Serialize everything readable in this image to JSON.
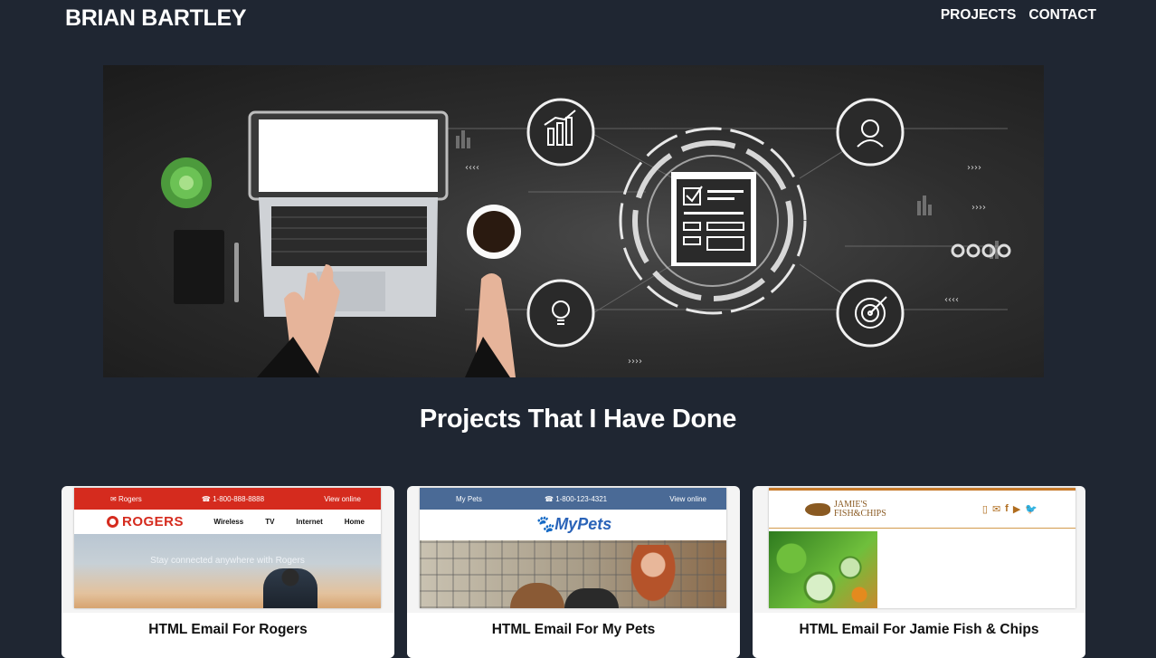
{
  "header": {
    "brand": "BRIAN BARTLEY",
    "nav": [
      {
        "label": "PROJECTS"
      },
      {
        "label": "CONTACT"
      }
    ]
  },
  "hero": {
    "image": "laptop-business-analytics-illustration"
  },
  "projects": {
    "heading": "Projects That I Have Done",
    "cards": [
      {
        "title": "HTML Email For Rogers",
        "preview": {
          "topbar": {
            "left": "Rogers",
            "phone": "1-800-888-8888",
            "right": "View online"
          },
          "logo": "ROGERS",
          "links": [
            "Wireless",
            "TV",
            "Internet",
            "Home"
          ],
          "tagline": "Stay connected anywhere with Rogers",
          "accent": "#d52b1e"
        }
      },
      {
        "title": "HTML Email For My Pets",
        "preview": {
          "topbar": {
            "left": "My Pets",
            "phone": "1-800-123-4321",
            "right": "View online"
          },
          "logo": "MyPets",
          "accent": "#4a6a96"
        }
      },
      {
        "title": "HTML Email For Jamie Fish & Chips",
        "preview": {
          "logo_line1": "JAMIE'S",
          "logo_line2": "FISH&CHIPS",
          "social_icons": [
            "phone-icon",
            "mail-icon",
            "facebook-icon",
            "youtube-icon",
            "twitter-icon"
          ],
          "accent": "#c77a2a"
        }
      }
    ]
  }
}
